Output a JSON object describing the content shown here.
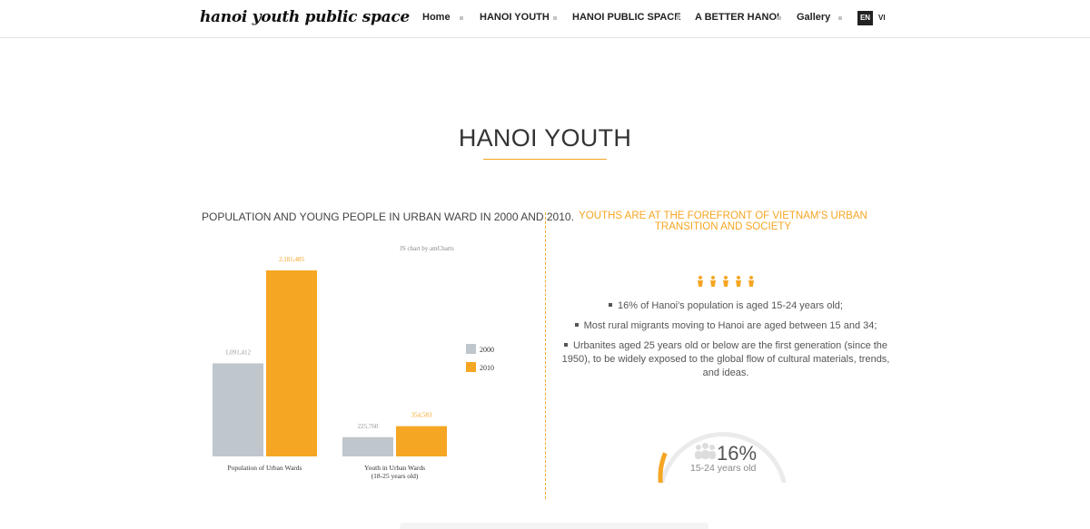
{
  "header": {
    "logo": "hanoi youth public space",
    "nav": [
      {
        "label": "Home"
      },
      {
        "label": "HANOI YOUTH"
      },
      {
        "label": "HANOI PUBLIC SPACE"
      },
      {
        "label": "A BETTER HANOI"
      },
      {
        "label": "Gallery"
      }
    ],
    "lang_active": "EN",
    "lang_other": "VI"
  },
  "section": {
    "title": "HANOI YOUTH"
  },
  "chart": {
    "heading": "POPULATION AND YOUNG PEOPLE IN URBAN WARD IN 2000 AND 2010.",
    "credit": "JS chart by amCharts"
  },
  "chart_data": {
    "type": "bar",
    "title": "POPULATION AND YOUNG PEOPLE IN URBAN WARD IN 2000 AND 2010.",
    "categories": [
      "Population of Urban Wards",
      "Youth in Urban Wards (18-25 years old)"
    ],
    "category_lines": [
      [
        "Population of Urban Wards"
      ],
      [
        "Youth in Urban Wards",
        "(18-25 years old)"
      ]
    ],
    "series": [
      {
        "name": "2000",
        "values": [
          1091412,
          225760
        ],
        "labels": [
          "1,091,412",
          "225,760"
        ],
        "color": "#bfc6cc"
      },
      {
        "name": "2010",
        "values": [
          2181485,
          354583
        ],
        "labels": [
          "2,181,485",
          "354,583"
        ],
        "color": "#f5a623"
      }
    ],
    "ylim": [
      0,
      2181485
    ],
    "grid": false,
    "legend": "right"
  },
  "right": {
    "heading": "YOUTHS ARE AT THE FOREFRONT OF VIETNAM'S URBAN TRANSITION AND SOCIETY",
    "facts": [
      "16% of Hanoi's population is aged 15-24 years old;",
      "Most rural migrants moving to Hanoi are aged between 15 and 34;",
      "Urbanites aged 25 years old or below are the first generation (since the 1950), to be widely exposed to the global flow of cultural materials, trends, and ideas."
    ],
    "gauge": {
      "percent_label": "16%",
      "percent_value": 16,
      "sub": "15-24 years old"
    }
  },
  "colors": {
    "accent": "#f5a623",
    "bar_2000": "#bfc6cc",
    "text_dark": "#222222"
  },
  "icons": {
    "people": "person-icon"
  }
}
